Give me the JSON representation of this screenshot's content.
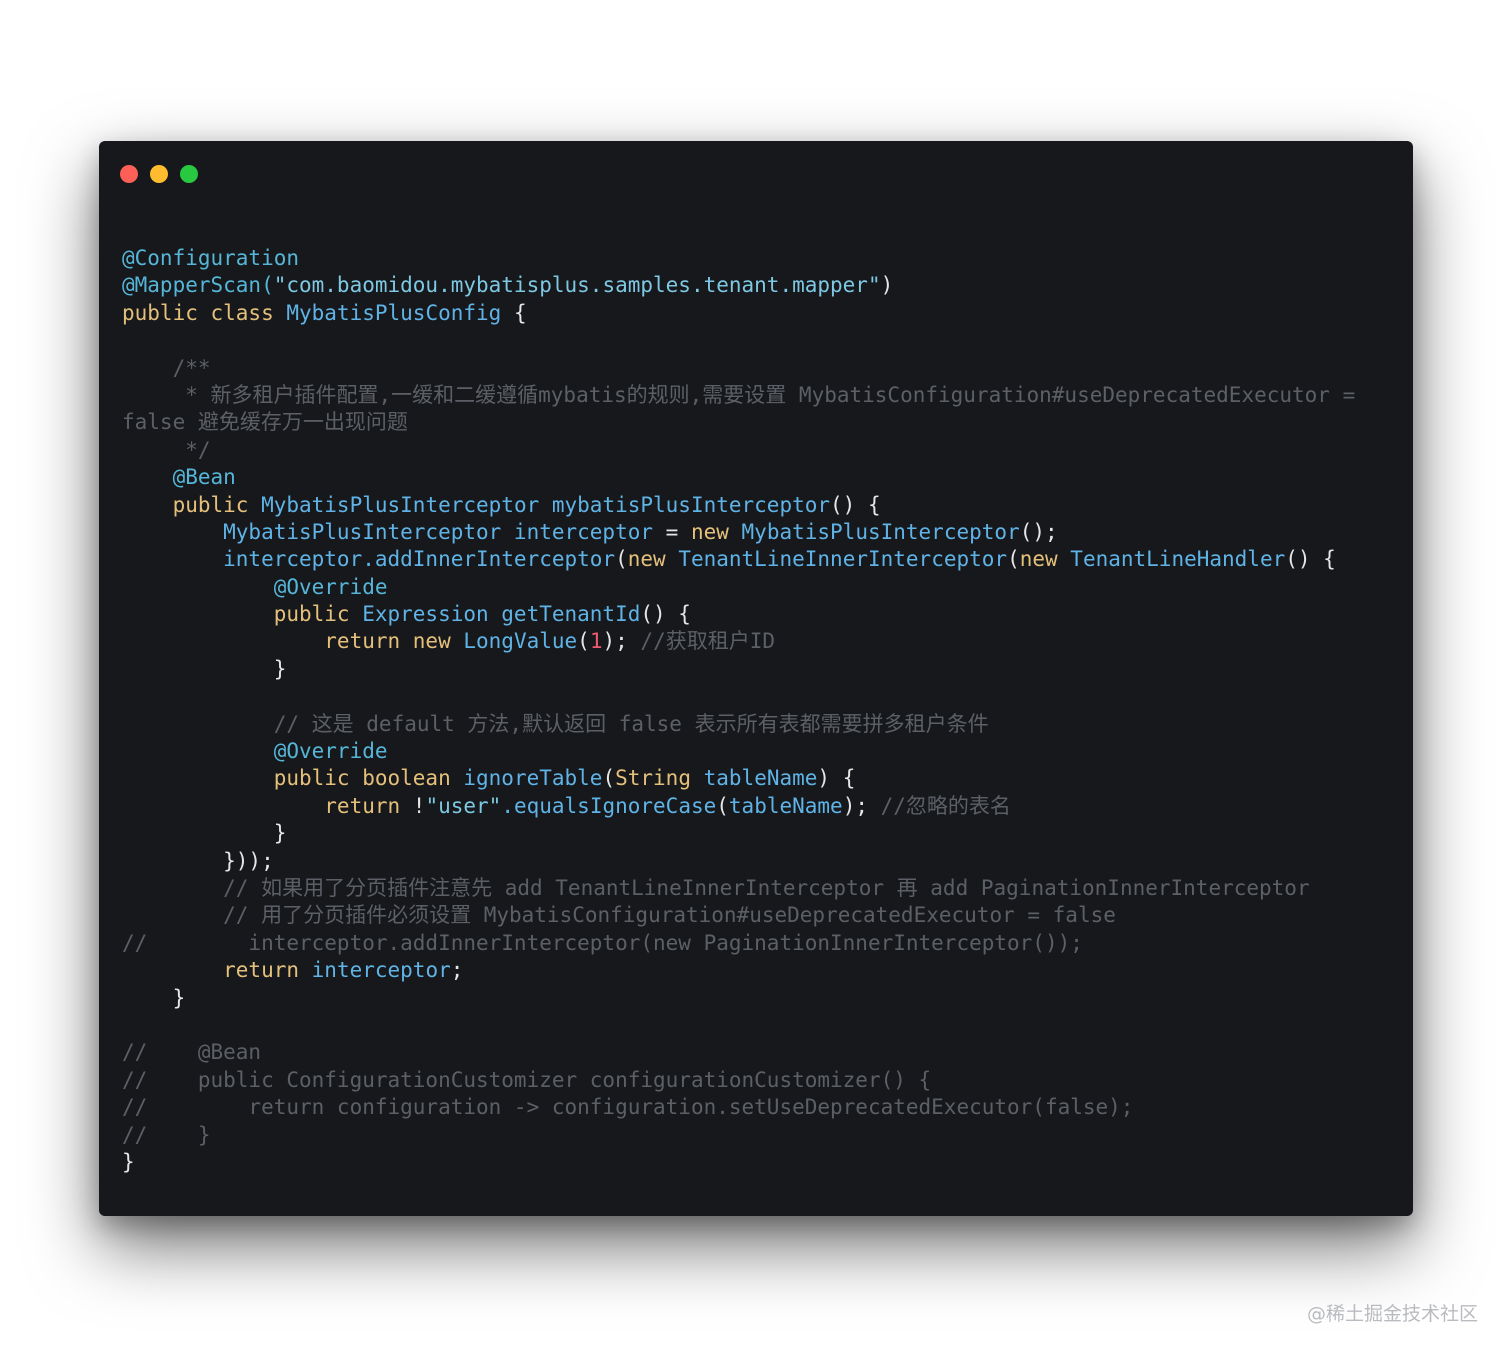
{
  "window": {
    "controls": [
      "close",
      "minimize",
      "maximize"
    ],
    "colors": {
      "background": "#16181b",
      "close": "#fe5f57",
      "minimize": "#febc2e",
      "maximize": "#28c840"
    }
  },
  "code": {
    "language": "java",
    "lines": [
      [
        {
          "t": "@Configuration",
          "c": "ann"
        }
      ],
      [
        {
          "t": "@MapperScan(",
          "c": "ann"
        },
        {
          "t": "\"com.baomidou.mybatisplus.samples.tenant.mapper\"",
          "c": "str"
        },
        {
          "t": ")",
          "c": "pl"
        }
      ],
      [
        {
          "t": "public class ",
          "c": "kw"
        },
        {
          "t": "MybatisPlusConfig",
          "c": "cls"
        },
        {
          "t": " {",
          "c": "pl"
        }
      ],
      [],
      [
        {
          "t": "    /**",
          "c": "cm"
        }
      ],
      [
        {
          "t": "     * 新多租户插件配置,一缓和二缓遵循mybatis的规则,需要设置 MybatisConfiguration#useDeprecatedExecutor =",
          "c": "cm"
        }
      ],
      [
        {
          "t": "false 避免缓存万一出现问题",
          "c": "cm"
        }
      ],
      [
        {
          "t": "     */",
          "c": "cm"
        }
      ],
      [
        {
          "t": "    @Bean",
          "c": "ann"
        }
      ],
      [
        {
          "t": "    public ",
          "c": "kw"
        },
        {
          "t": "MybatisPlusInterceptor mybatisPlusInterceptor",
          "c": "fn"
        },
        {
          "t": "() {",
          "c": "pl"
        }
      ],
      [
        {
          "t": "        MybatisPlusInterceptor interceptor",
          "c": "fn"
        },
        {
          "t": " = ",
          "c": "pl"
        },
        {
          "t": "new ",
          "c": "kw"
        },
        {
          "t": "MybatisPlusInterceptor",
          "c": "fn"
        },
        {
          "t": "();",
          "c": "pl"
        }
      ],
      [
        {
          "t": "        interceptor.addInnerInterceptor",
          "c": "fn"
        },
        {
          "t": "(",
          "c": "pl"
        },
        {
          "t": "new ",
          "c": "kw"
        },
        {
          "t": "TenantLineInnerInterceptor",
          "c": "fn"
        },
        {
          "t": "(",
          "c": "pl"
        },
        {
          "t": "new ",
          "c": "kw"
        },
        {
          "t": "TenantLineHandler",
          "c": "fn"
        },
        {
          "t": "() {",
          "c": "pl"
        }
      ],
      [
        {
          "t": "            @Override",
          "c": "ann"
        }
      ],
      [
        {
          "t": "            public ",
          "c": "kw"
        },
        {
          "t": "Expression getTenantId",
          "c": "fn"
        },
        {
          "t": "() {",
          "c": "pl"
        }
      ],
      [
        {
          "t": "                return new ",
          "c": "kw"
        },
        {
          "t": "LongValue",
          "c": "fn"
        },
        {
          "t": "(",
          "c": "pl"
        },
        {
          "t": "1",
          "c": "num"
        },
        {
          "t": "); ",
          "c": "pl"
        },
        {
          "t": "//获取租户ID",
          "c": "cm"
        }
      ],
      [
        {
          "t": "            }",
          "c": "pl"
        }
      ],
      [],
      [
        {
          "t": "            // 这是 default 方法,默认返回 false 表示所有表都需要拼多租户条件",
          "c": "cm"
        }
      ],
      [
        {
          "t": "            @Override",
          "c": "ann"
        }
      ],
      [
        {
          "t": "            public boolean ",
          "c": "kw"
        },
        {
          "t": "ignoreTable",
          "c": "fn"
        },
        {
          "t": "(",
          "c": "pl"
        },
        {
          "t": "String ",
          "c": "kw"
        },
        {
          "t": "tableName",
          "c": "fn"
        },
        {
          "t": ") {",
          "c": "pl"
        }
      ],
      [
        {
          "t": "                return ",
          "c": "kw"
        },
        {
          "t": "!",
          "c": "pl"
        },
        {
          "t": "\"user\"",
          "c": "str"
        },
        {
          "t": ".equalsIgnoreCase",
          "c": "fn"
        },
        {
          "t": "(",
          "c": "pl"
        },
        {
          "t": "tableName",
          "c": "fn"
        },
        {
          "t": "); ",
          "c": "pl"
        },
        {
          "t": "//忽略的表名",
          "c": "cm"
        }
      ],
      [
        {
          "t": "            }",
          "c": "pl"
        }
      ],
      [
        {
          "t": "        }));",
          "c": "pl"
        }
      ],
      [
        {
          "t": "        // 如果用了分页插件注意先 add TenantLineInnerInterceptor 再 add PaginationInnerInterceptor",
          "c": "cm"
        }
      ],
      [
        {
          "t": "        // 用了分页插件必须设置 MybatisConfiguration#useDeprecatedExecutor = false",
          "c": "cm"
        }
      ],
      [
        {
          "t": "//        interceptor.addInnerInterceptor(new PaginationInnerInterceptor());",
          "c": "cm"
        }
      ],
      [
        {
          "t": "        return ",
          "c": "kw"
        },
        {
          "t": "interceptor",
          "c": "fn"
        },
        {
          "t": ";",
          "c": "pl"
        }
      ],
      [
        {
          "t": "    }",
          "c": "pl"
        }
      ],
      [],
      [
        {
          "t": "//    @Bean",
          "c": "cm"
        }
      ],
      [
        {
          "t": "//    public ConfigurationCustomizer configurationCustomizer() {",
          "c": "cm"
        }
      ],
      [
        {
          "t": "//        return configuration -> configuration.setUseDeprecatedExecutor(false);",
          "c": "cm"
        }
      ],
      [
        {
          "t": "//    }",
          "c": "cm"
        }
      ],
      [
        {
          "t": "}",
          "c": "pl"
        }
      ]
    ]
  },
  "watermark": "@稀土掘金技术社区"
}
